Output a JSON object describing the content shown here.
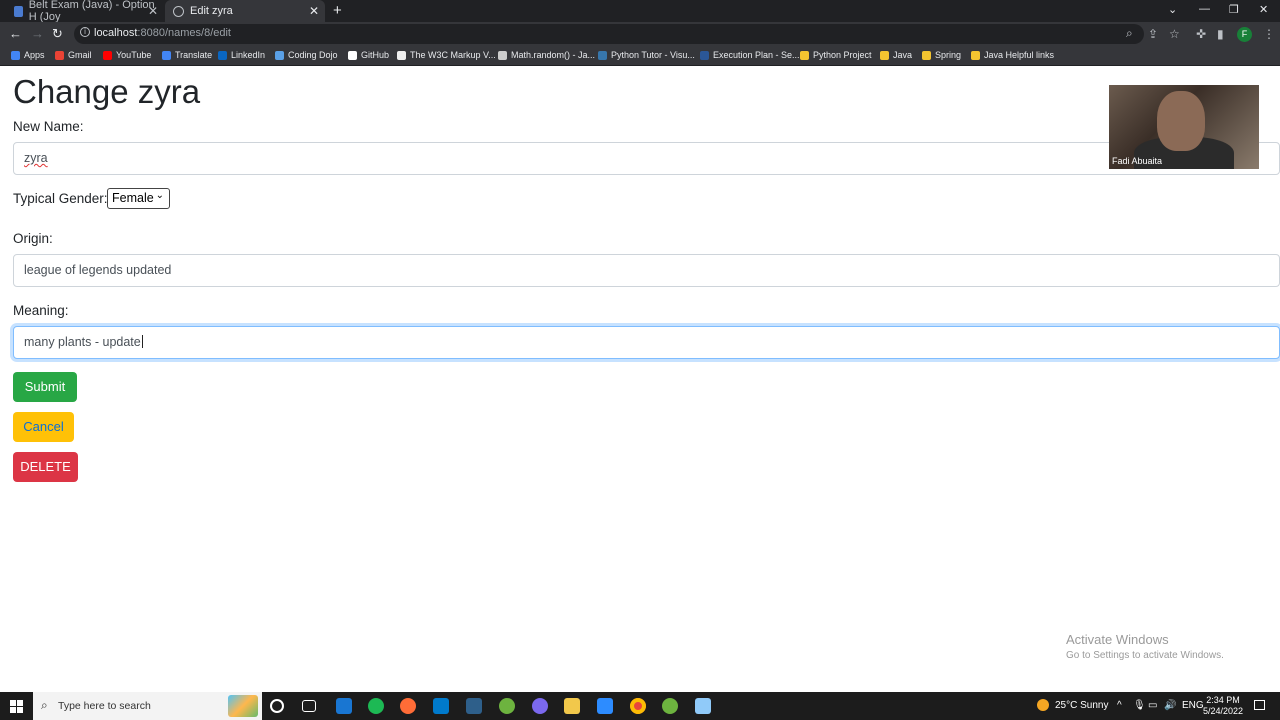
{
  "browser": {
    "tabs": [
      {
        "title": "Belt Exam (Java) - Option H (Joy",
        "active": false
      },
      {
        "title": "Edit zyra",
        "active": true
      }
    ],
    "url_host": "localhost",
    "url_path": ":8080/names/8/edit",
    "profile_initial": "F",
    "bookmarks": [
      "Apps",
      "Gmail",
      "YouTube",
      "Translate",
      "LinkedIn",
      "Coding Dojo",
      "GitHub",
      "The W3C Markup V...",
      "Math.random() - Ja...",
      "Python Tutor - Visu...",
      "Execution Plan - Se...",
      "Python Project",
      "Java",
      "Spring",
      "Java Helpful links"
    ]
  },
  "page": {
    "title": "Change zyra",
    "name_label": "New Name:",
    "name_value": "zyra",
    "gender_label": "Typical Gender:",
    "gender_value": "Female",
    "origin_label": "Origin:",
    "origin_value": "league of legends updated",
    "meaning_label": "Meaning:",
    "meaning_value": "many plants - update",
    "submit_label": "Submit",
    "cancel_label": "Cancel",
    "delete_label": "DELETE"
  },
  "webcam": {
    "name": "Fadi Abuaita"
  },
  "watermark": {
    "line1": "Activate Windows",
    "line2": "Go to Settings to activate Windows."
  },
  "taskbar": {
    "search_placeholder": "Type here to search",
    "weather": "25°C  Sunny",
    "language": "ENG",
    "time": "2:34 PM",
    "date": "5/24/2022"
  },
  "colors": {
    "submit": "#28a745",
    "cancel": "#ffc107",
    "delete": "#dc3545",
    "focus": "#80bdff"
  }
}
